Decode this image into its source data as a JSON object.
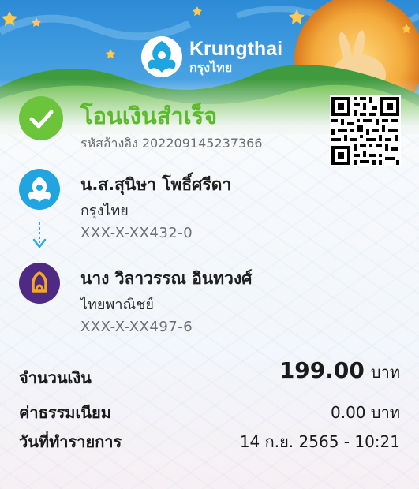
{
  "brand": {
    "name": "Krungthai",
    "name_th": "กรุงไทย"
  },
  "status": {
    "title": "โอนเงินสำเร็จ",
    "reference": "รหัสอ้างอิง 202209145237366"
  },
  "sender": {
    "name": "น.ส.สุนิษา โพธิ์ศรีดา",
    "bank": "กรุงไทย",
    "account": "XXX-X-XX432-0"
  },
  "recipient": {
    "name": "นาง วิลาวรรณ อินทวงศ์",
    "bank": "ไทยพาณิชย์",
    "account": "XXX-X-XX497-6"
  },
  "details": {
    "amount_label": "จำนวนเงิน",
    "amount_value": "199.00",
    "amount_unit": "บาท",
    "fee_label": "ค่าธรรมเนียม",
    "fee_value": "0.00 บาท",
    "date_label": "วันที่ทำรายการ",
    "date_value": "14 ก.ย. 2565 - 10:21"
  },
  "colors": {
    "success": "#6cc43b",
    "krungthai": "#20a5e0",
    "scb": "#4e2a84",
    "scb_accent": "#f5a623"
  },
  "icons": [
    "check-icon",
    "qr-code",
    "krungthai-logo",
    "scb-logo",
    "down-arrow-icon"
  ]
}
